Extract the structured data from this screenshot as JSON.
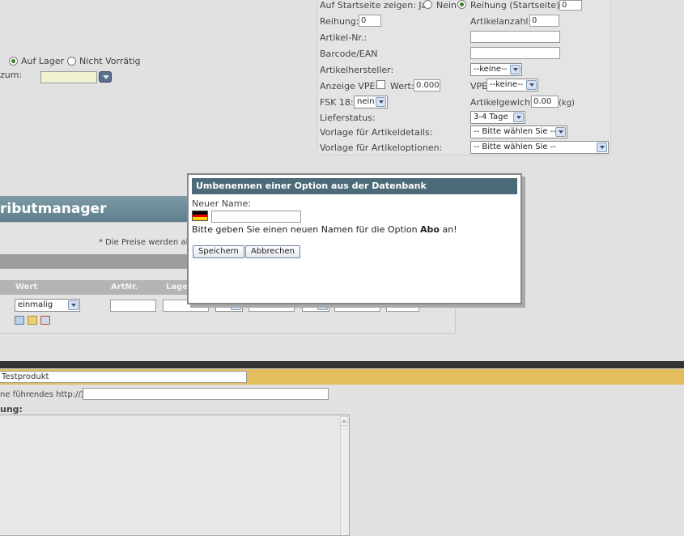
{
  "left_stock": {
    "option_in_stock": "Auf Lager",
    "option_not_in_stock": "Nicht Vorrätig",
    "date_label_fragment": "zum:"
  },
  "props": {
    "startpage_label": "Auf Startseite zeigen: Ja",
    "startpage_no": "Nein",
    "order_startpage_label": "Reihung (Startseite):",
    "order_startpage_value": "0",
    "order_label": "Reihung:",
    "order_value": "0",
    "article_count_label": "Artikelanzahl:",
    "article_count_value": "0",
    "article_nr_label": "Artikel-Nr.:",
    "barcode_label": "Barcode/EAN",
    "manufacturer_label": "Artikelhersteller:",
    "manufacturer_value": "--keine--",
    "show_vpe_label": "Anzeige VPE:",
    "value_label": "Wert:",
    "value_value": "0.0000",
    "vpe_label": "VPE",
    "vpe_value": "--keine--",
    "fsk_label": "FSK 18:",
    "fsk_value": "nein",
    "weight_label": "Artikelgewicht:",
    "weight_value": "0.00",
    "weight_unit": "(kg)",
    "delivery_label": "Lieferstatus:",
    "delivery_value": "3-4 Tage",
    "template_details_label": "Vorlage für Artikeldetails:",
    "template_details_value": "-- Bitte wählen Sie --",
    "template_options_label": "Vorlage für Artikeloptionen:",
    "template_options_value": "-- Bitte wählen Sie --"
  },
  "attr": {
    "title_fragment": "ributmanager",
    "price_note_fragment": "* Die Preise werden als",
    "col_value": "Wert",
    "col_artnr": "ArtNr.",
    "col_stock_fragment": "Lage",
    "value_select": "einmalig",
    "plus_minus_1": "+",
    "plus_minus_2": "+"
  },
  "bottom": {
    "product_name": "Testprodukt",
    "url_label_fragment": "ne führendes http://)",
    "desc_label_fragment": "ung:"
  },
  "dialog": {
    "title": "Umbenennen einer Option aus der Datenbank",
    "new_name_label": "Neuer Name:",
    "hint_prefix": "Bitte geben Sie einen neuen Namen für die Option",
    "option_name": "Abo",
    "hint_suffix": "an!",
    "save_button": "Speichern",
    "cancel_button": "Abbrechen",
    "flag_colors": [
      "#000000",
      "#dd0000",
      "#ffce00"
    ]
  }
}
